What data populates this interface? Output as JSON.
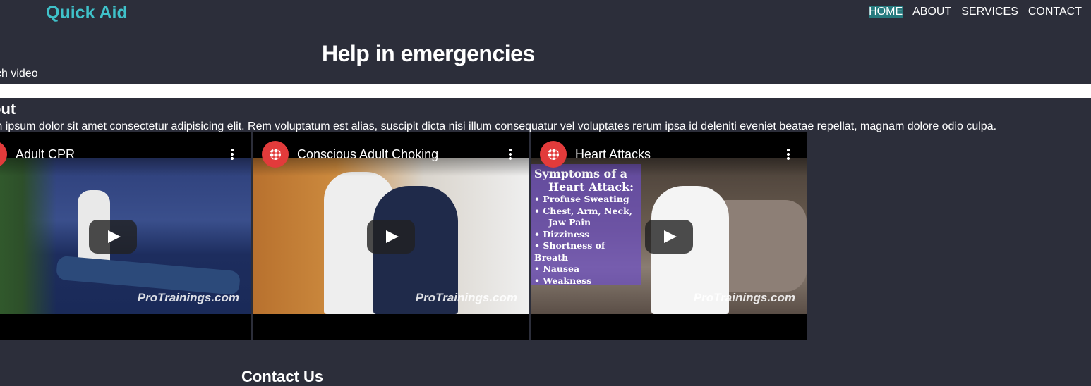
{
  "header": {
    "logo": "Quick Aid",
    "nav": [
      {
        "label": "HOME",
        "active": true
      },
      {
        "label": "ABOUT"
      },
      {
        "label": "SERVICES"
      },
      {
        "label": "CONTACT"
      }
    ]
  },
  "hero": {
    "title": "Help in emergencies",
    "watch_link": "ch video"
  },
  "about": {
    "heading": "out",
    "text": "m ipsum dolor sit amet consectetur adipisicing elit. Rem voluptatum est alias, suscipit dicta nisi illum consequatur vel voluptates rerum ipsa id deleniti eveniet beatae repellat, magnam dolore odio culpa."
  },
  "videos": [
    {
      "title": "Adult CPR",
      "watermark": "ProTrainings.com"
    },
    {
      "title": "Conscious Adult Choking",
      "watermark": "ProTrainings.com"
    },
    {
      "title": "Heart Attacks",
      "watermark": "ProTrainings.com",
      "overlay": {
        "heading": [
          "Symptoms of a",
          "Heart Attack:"
        ],
        "items": [
          "• Profuse Sweating",
          "• Chest, Arm, Neck,",
          "Jaw Pain",
          "• Dizziness",
          "• Shortness of Breath",
          "• Nausea",
          "• Weakness"
        ]
      }
    }
  ],
  "contact_heading": "Contact Us",
  "colors": {
    "background": "#2c2e3a",
    "accent": "#3fc1c9",
    "nav_active": "#267a7e"
  }
}
